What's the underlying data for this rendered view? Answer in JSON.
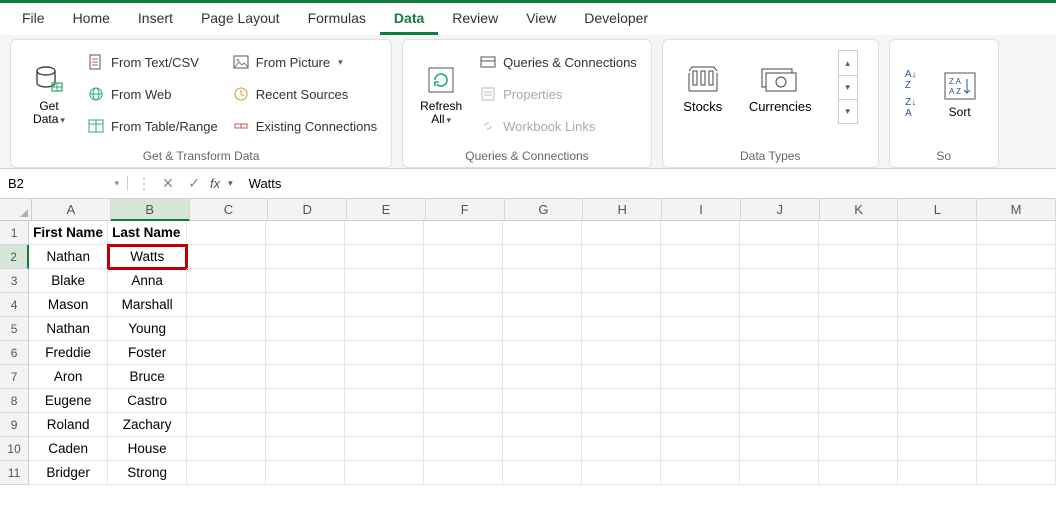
{
  "tabs": {
    "file": "File",
    "home": "Home",
    "insert": "Insert",
    "pageLayout": "Page Layout",
    "formulas": "Formulas",
    "data": "Data",
    "review": "Review",
    "view": "View",
    "developer": "Developer"
  },
  "ribbon": {
    "getTransform": {
      "label": "Get & Transform Data",
      "getData": "Get\nData",
      "fromTextCsv": "From Text/CSV",
      "fromWeb": "From Web",
      "fromTableRange": "From Table/Range",
      "fromPicture": "From Picture",
      "recentSources": "Recent Sources",
      "existingConnections": "Existing Connections"
    },
    "queries": {
      "label": "Queries & Connections",
      "refreshAll": "Refresh\nAll",
      "queriesConn": "Queries & Connections",
      "properties": "Properties",
      "workbookLinks": "Workbook Links"
    },
    "dataTypes": {
      "label": "Data Types",
      "stocks": "Stocks",
      "currencies": "Currencies"
    },
    "sort": {
      "label": "Sort",
      "cutoff": "So"
    }
  },
  "formulaBar": {
    "nameBox": "B2",
    "fx": "fx",
    "value": "Watts"
  },
  "grid": {
    "columns": [
      "A",
      "B",
      "C",
      "D",
      "E",
      "F",
      "G",
      "H",
      "I",
      "J",
      "K",
      "L",
      "M"
    ],
    "selectedCol": 1,
    "selectedRow": 2,
    "headers": {
      "A": "First Name",
      "B": "Last Name"
    },
    "rows": [
      {
        "n": 1,
        "A": "First Name",
        "B": "Last Name"
      },
      {
        "n": 2,
        "A": "Nathan",
        "B": "Watts"
      },
      {
        "n": 3,
        "A": "Blake",
        "B": "Anna"
      },
      {
        "n": 4,
        "A": "Mason",
        "B": "Marshall"
      },
      {
        "n": 5,
        "A": "Nathan",
        "B": "Young"
      },
      {
        "n": 6,
        "A": "Freddie",
        "B": "Foster"
      },
      {
        "n": 7,
        "A": "Aron",
        "B": "Bruce"
      },
      {
        "n": 8,
        "A": "Eugene",
        "B": "Castro"
      },
      {
        "n": 9,
        "A": "Roland",
        "B": "Zachary"
      },
      {
        "n": 10,
        "A": "Caden",
        "B": "House"
      },
      {
        "n": 11,
        "A": "Bridger",
        "B": "Strong"
      }
    ]
  }
}
